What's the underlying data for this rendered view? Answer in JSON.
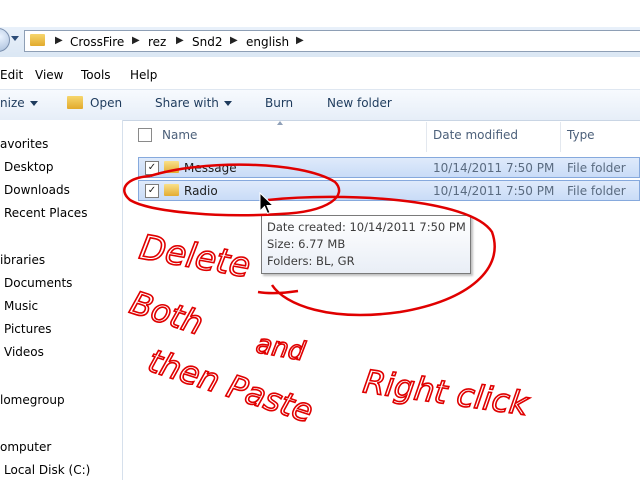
{
  "address": {
    "crumbs": [
      "CrossFire",
      "rez",
      "Snd2",
      "english"
    ]
  },
  "menubar": {
    "items": [
      "Edit",
      "View",
      "Tools",
      "Help"
    ]
  },
  "toolbar": {
    "organize_label": "nize",
    "open_label": "Open",
    "share_label": "Share with",
    "burn_label": "Burn",
    "new_folder_label": "New folder"
  },
  "navpane": {
    "favorites": "avorites",
    "fav_items": [
      "Desktop",
      "Downloads",
      "Recent Places"
    ],
    "libraries": "ibraries",
    "lib_items": [
      "Documents",
      "Music",
      "Pictures",
      "Videos"
    ],
    "homegroup": "lomegroup",
    "computer": "omputer",
    "comp_items": [
      "Local Disk (C:)"
    ]
  },
  "columns": {
    "name": "Name",
    "date": "Date modified",
    "type": "Type"
  },
  "files": [
    {
      "name": "Message",
      "date": "10/14/2011 7:50 PM",
      "type": "File folder",
      "checked": true
    },
    {
      "name": "Radio",
      "date": "10/14/2011 7:50 PM",
      "type": "File folder",
      "checked": true
    }
  ],
  "tooltip": {
    "line1": "Date created: 10/14/2011 7:50 PM",
    "line2": "Size: 6.77 MB",
    "line3": "Folders: BL, GR"
  },
  "annotation": {
    "color": "#e00000",
    "word1": "Delete",
    "word2": "Both",
    "word3": "and",
    "word4": "Right click",
    "word5": "then Paste"
  },
  "check_glyph": "✓"
}
